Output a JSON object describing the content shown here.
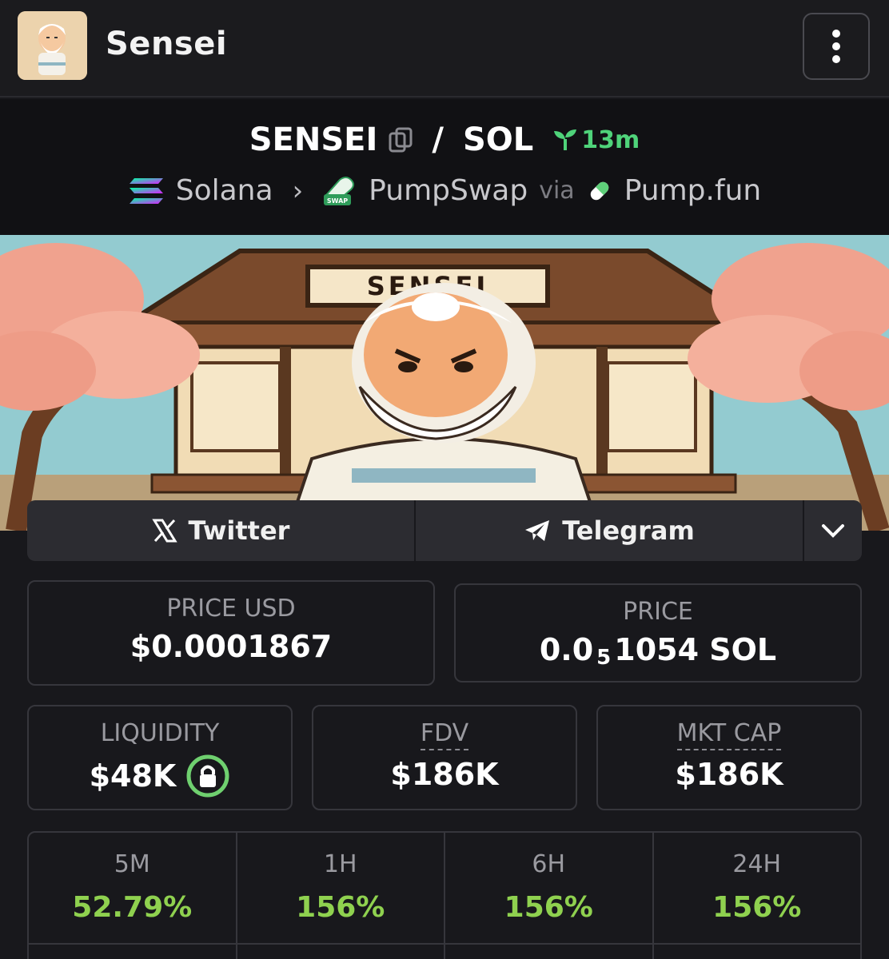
{
  "header": {
    "title": "Sensei",
    "avatar_icon": "sensei-avatar",
    "menu_icon": "kebab-menu-icon"
  },
  "pair": {
    "base": "SENSEI",
    "slash": "/",
    "quote": "SOL",
    "age": "13m",
    "chain": "Solana",
    "dex": "PumpSwap",
    "via": "via",
    "launchpad": "Pump.fun"
  },
  "banner": {
    "sign_text": "SENSEI"
  },
  "social": {
    "twitter": "Twitter",
    "telegram": "Telegram"
  },
  "stats": {
    "price_usd_label": "PRICE USD",
    "price_usd_value": "$0.0001867",
    "price_label": "PRICE",
    "price_prefix": "0.0",
    "price_sub": "5",
    "price_suffix": "1054 SOL",
    "liquidity_label": "LIQUIDITY",
    "liquidity_value": "$48K",
    "fdv_label": "FDV",
    "fdv_value": "$186K",
    "mktcap_label": "MKT CAP",
    "mktcap_value": "$186K"
  },
  "changes": [
    {
      "label": "5M",
      "value": "52.79%"
    },
    {
      "label": "1H",
      "value": "156%"
    },
    {
      "label": "6H",
      "value": "156%"
    },
    {
      "label": "24H",
      "value": "156%"
    }
  ],
  "colors": {
    "accent_green": "#4fd37a",
    "change_green": "#8fd14f",
    "background": "#18181c"
  }
}
